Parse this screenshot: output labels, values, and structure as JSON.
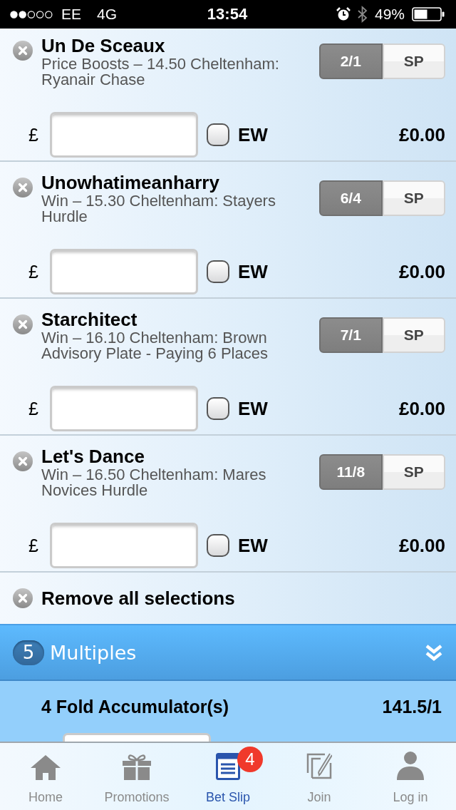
{
  "status_bar": {
    "carrier": "EE",
    "network": "4G",
    "time": "13:54",
    "battery": "49%"
  },
  "selections": [
    {
      "name": "Un De Sceaux",
      "market": "Price Boosts – 14.50 Cheltenham: Ryanair Chase",
      "prices": [
        {
          "label": "2/1",
          "selected": true
        },
        {
          "label": "SP",
          "selected": false
        }
      ],
      "currency": "£",
      "each_way": {
        "label": "EW",
        "checked": false
      },
      "returns": "£0.00"
    },
    {
      "name": "Unowhatimeanharry",
      "market": "Win – 15.30 Cheltenham: Stayers Hurdle",
      "prices": [
        {
          "label": "6/4",
          "selected": true
        },
        {
          "label": "SP",
          "selected": false
        }
      ],
      "currency": "£",
      "each_way": {
        "label": "EW",
        "checked": false
      },
      "returns": "£0.00"
    },
    {
      "name": "Starchitect",
      "market": "Win – 16.10 Cheltenham: Brown Advisory Plate - Paying 6 Places",
      "prices": [
        {
          "label": "7/1",
          "selected": true
        },
        {
          "label": "SP",
          "selected": false
        }
      ],
      "currency": "£",
      "each_way": {
        "label": "EW",
        "checked": false
      },
      "returns": "£0.00"
    },
    {
      "name": "Let's Dance",
      "market": "Win – 16.50 Cheltenham: Mares Novices Hurdle",
      "prices": [
        {
          "label": "11/8",
          "selected": true
        },
        {
          "label": "SP",
          "selected": false
        }
      ],
      "currency": "£",
      "each_way": {
        "label": "EW",
        "checked": false
      },
      "returns": "£0.00"
    }
  ],
  "remove_all": {
    "label": "Remove all selections"
  },
  "multiples": {
    "count": "5",
    "title": "Multiples"
  },
  "accumulator": {
    "label": "4 Fold Accumulator(s)",
    "odds": "141.5/1"
  },
  "tab_bar": [
    {
      "label": "Home",
      "selected": false
    },
    {
      "label": "Promotions",
      "selected": false
    },
    {
      "label": "Bet Slip",
      "selected": true,
      "badge": "4"
    },
    {
      "label": "Join",
      "selected": false
    },
    {
      "label": "Log in",
      "selected": false
    }
  ]
}
